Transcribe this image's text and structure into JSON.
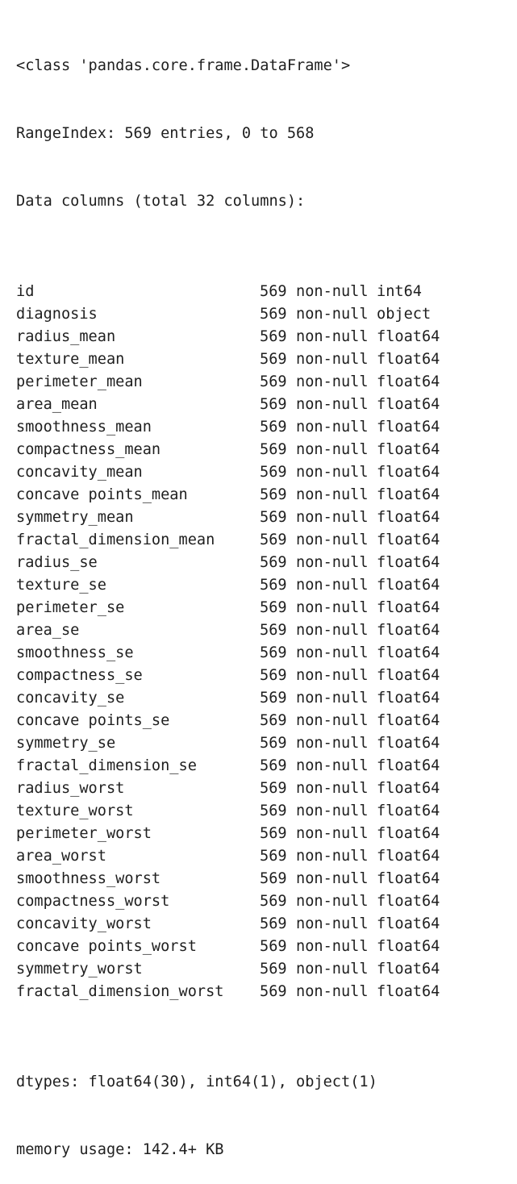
{
  "header": {
    "class_line": "<class 'pandas.core.frame.DataFrame'>",
    "range_index_line": "RangeIndex: 569 entries, 0 to 568",
    "data_columns_line": "Data columns (total 32 columns):"
  },
  "columns": [
    {
      "name": "id",
      "count": "569",
      "nullness": "non-null",
      "dtype": "int64"
    },
    {
      "name": "diagnosis",
      "count": "569",
      "nullness": "non-null",
      "dtype": "object"
    },
    {
      "name": "radius_mean",
      "count": "569",
      "nullness": "non-null",
      "dtype": "float64"
    },
    {
      "name": "texture_mean",
      "count": "569",
      "nullness": "non-null",
      "dtype": "float64"
    },
    {
      "name": "perimeter_mean",
      "count": "569",
      "nullness": "non-null",
      "dtype": "float64"
    },
    {
      "name": "area_mean",
      "count": "569",
      "nullness": "non-null",
      "dtype": "float64"
    },
    {
      "name": "smoothness_mean",
      "count": "569",
      "nullness": "non-null",
      "dtype": "float64"
    },
    {
      "name": "compactness_mean",
      "count": "569",
      "nullness": "non-null",
      "dtype": "float64"
    },
    {
      "name": "concavity_mean",
      "count": "569",
      "nullness": "non-null",
      "dtype": "float64"
    },
    {
      "name": "concave points_mean",
      "count": "569",
      "nullness": "non-null",
      "dtype": "float64"
    },
    {
      "name": "symmetry_mean",
      "count": "569",
      "nullness": "non-null",
      "dtype": "float64"
    },
    {
      "name": "fractal_dimension_mean",
      "count": "569",
      "nullness": "non-null",
      "dtype": "float64"
    },
    {
      "name": "radius_se",
      "count": "569",
      "nullness": "non-null",
      "dtype": "float64"
    },
    {
      "name": "texture_se",
      "count": "569",
      "nullness": "non-null",
      "dtype": "float64"
    },
    {
      "name": "perimeter_se",
      "count": "569",
      "nullness": "non-null",
      "dtype": "float64"
    },
    {
      "name": "area_se",
      "count": "569",
      "nullness": "non-null",
      "dtype": "float64"
    },
    {
      "name": "smoothness_se",
      "count": "569",
      "nullness": "non-null",
      "dtype": "float64"
    },
    {
      "name": "compactness_se",
      "count": "569",
      "nullness": "non-null",
      "dtype": "float64"
    },
    {
      "name": "concavity_se",
      "count": "569",
      "nullness": "non-null",
      "dtype": "float64"
    },
    {
      "name": "concave points_se",
      "count": "569",
      "nullness": "non-null",
      "dtype": "float64"
    },
    {
      "name": "symmetry_se",
      "count": "569",
      "nullness": "non-null",
      "dtype": "float64"
    },
    {
      "name": "fractal_dimension_se",
      "count": "569",
      "nullness": "non-null",
      "dtype": "float64"
    },
    {
      "name": "radius_worst",
      "count": "569",
      "nullness": "non-null",
      "dtype": "float64"
    },
    {
      "name": "texture_worst",
      "count": "569",
      "nullness": "non-null",
      "dtype": "float64"
    },
    {
      "name": "perimeter_worst",
      "count": "569",
      "nullness": "non-null",
      "dtype": "float64"
    },
    {
      "name": "area_worst",
      "count": "569",
      "nullness": "non-null",
      "dtype": "float64"
    },
    {
      "name": "smoothness_worst",
      "count": "569",
      "nullness": "non-null",
      "dtype": "float64"
    },
    {
      "name": "compactness_worst",
      "count": "569",
      "nullness": "non-null",
      "dtype": "float64"
    },
    {
      "name": "concavity_worst",
      "count": "569",
      "nullness": "non-null",
      "dtype": "float64"
    },
    {
      "name": "concave points_worst",
      "count": "569",
      "nullness": "non-null",
      "dtype": "float64"
    },
    {
      "name": "symmetry_worst",
      "count": "569",
      "nullness": "non-null",
      "dtype": "float64"
    },
    {
      "name": "fractal_dimension_worst",
      "count": "569",
      "nullness": "non-null",
      "dtype": "float64"
    }
  ],
  "footer": {
    "dtypes_line": "dtypes: float64(30), int64(1), object(1)",
    "memory_line": "memory usage: 142.4+ KB"
  },
  "colors": {
    "text": "#1f1f1f",
    "background": "#ffffff"
  }
}
